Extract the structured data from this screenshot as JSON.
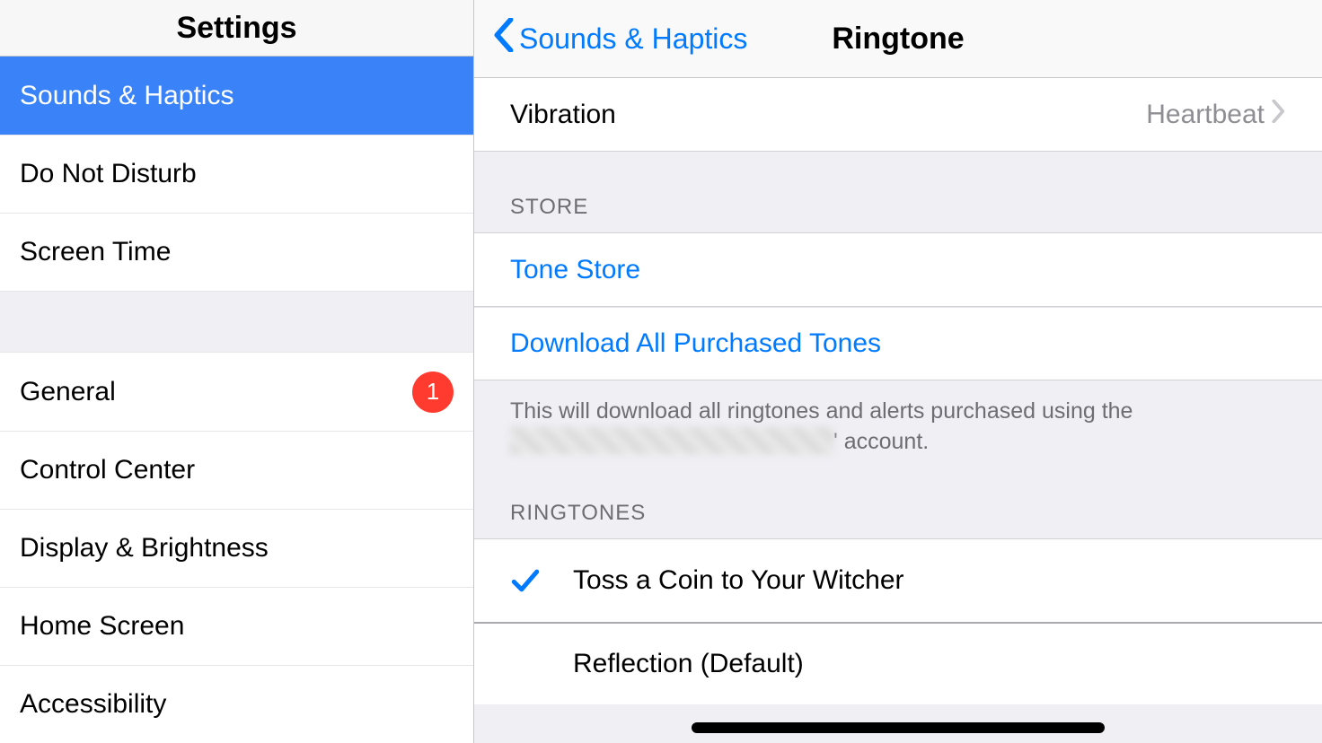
{
  "sidebar": {
    "title": "Settings",
    "group1": [
      {
        "label": "Sounds & Haptics",
        "selected": true,
        "badge": null
      },
      {
        "label": "Do Not Disturb",
        "selected": false,
        "badge": null
      },
      {
        "label": "Screen Time",
        "selected": false,
        "badge": null
      }
    ],
    "group2": [
      {
        "label": "General",
        "selected": false,
        "badge": "1"
      },
      {
        "label": "Control Center",
        "selected": false,
        "badge": null
      },
      {
        "label": "Display & Brightness",
        "selected": false,
        "badge": null
      },
      {
        "label": "Home Screen",
        "selected": false,
        "badge": null
      },
      {
        "label": "Accessibility",
        "selected": false,
        "badge": null
      }
    ]
  },
  "nav": {
    "back_label": "Sounds & Haptics",
    "title": "Ringtone"
  },
  "vibration": {
    "label": "Vibration",
    "value": "Heartbeat"
  },
  "store": {
    "header": "STORE",
    "tone_store": "Tone Store",
    "download_all": "Download All Purchased Tones",
    "footnote_prefix": "This will download all ringtones and alerts purchased using the ",
    "footnote_suffix": "' account."
  },
  "ringtones": {
    "header": "RINGTONES",
    "items": [
      {
        "label": "Toss a Coin to Your Witcher",
        "checked": true
      },
      {
        "label": "Reflection (Default)",
        "checked": false
      }
    ]
  }
}
